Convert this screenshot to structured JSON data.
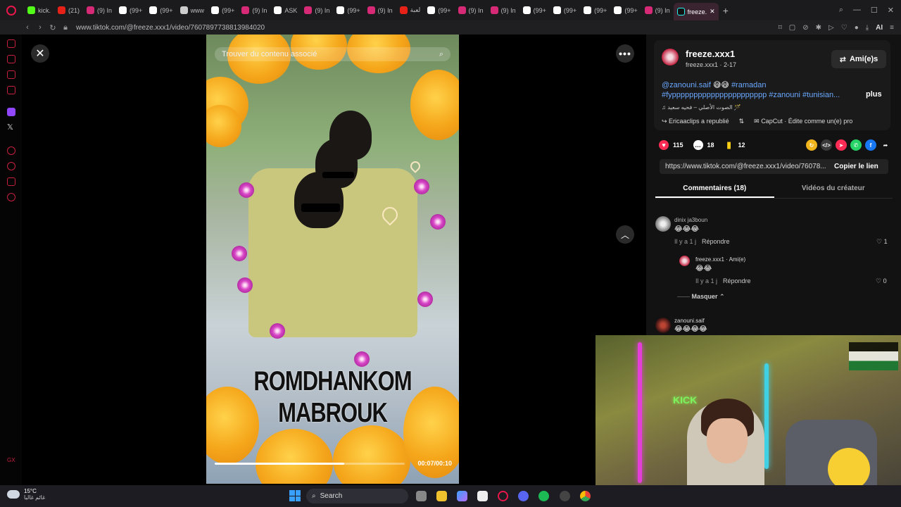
{
  "browser": {
    "tabs": [
      {
        "label": "kick.",
        "color": "#53fc18"
      },
      {
        "label": "(21)",
        "color": "#e62117"
      },
      {
        "label": "(9) In",
        "color": "#d62976"
      },
      {
        "label": "(99+",
        "color": "#ffffff"
      },
      {
        "label": "(99+",
        "color": "#ffffff"
      },
      {
        "label": "www",
        "color": "#cccccc"
      },
      {
        "label": "(99+",
        "color": "#ffffff"
      },
      {
        "label": "(9) In",
        "color": "#d62976"
      },
      {
        "label": "ASK",
        "color": "#ffffff"
      },
      {
        "label": "(9) In",
        "color": "#d62976"
      },
      {
        "label": "(99+",
        "color": "#ffffff"
      },
      {
        "label": "(9) In",
        "color": "#d62976"
      },
      {
        "label": "لعبة",
        "color": "#e62117"
      },
      {
        "label": "(99+",
        "color": "#ffffff"
      },
      {
        "label": "(9) In",
        "color": "#d62976"
      },
      {
        "label": "(9) In",
        "color": "#d62976"
      },
      {
        "label": "(99+",
        "color": "#ffffff"
      },
      {
        "label": "(99+",
        "color": "#ffffff"
      },
      {
        "label": "(99+",
        "color": "#ffffff"
      },
      {
        "label": "(99+",
        "color": "#ffffff"
      },
      {
        "label": "(9) In",
        "color": "#d62976"
      }
    ],
    "active_tab": "freeze.",
    "url": "www.tiktok.com/@freeze.xxx1/video/7607897738813984020",
    "ai_label": "AI"
  },
  "video": {
    "search_placeholder": "Trouver du contenu associé",
    "caption": "ROMDHANKOM MABROUK",
    "timecode": "00:07/00:10",
    "progress": 0.68
  },
  "post": {
    "author_name": "freeze.xxx1",
    "author_sub": "freeze.xxx1 · 2-17",
    "friends_button": "Ami(e)s",
    "desc_mention": "@zanouni.saif",
    "desc_emoji": "😅😅",
    "desc_tag1": "#ramadan",
    "desc_line2": "#fypppppppppppppppppppppp #zanouni #tunisian...",
    "more_label": "plus",
    "music": "الصوت الأصلي – فحيه سعيد 🪄",
    "repost_label": "Ericaaclips a republié",
    "capcut_label": "CapCut · Édite comme un(e) pro",
    "likes": "115",
    "comments": "18",
    "saves": "12",
    "link": "https://www.tiktok.com/@freeze.xxx1/video/76078...",
    "copy_label": "Copier le lien",
    "tab_comments": "Commentaires (18)",
    "tab_videos": "Vidéos du créateur"
  },
  "comments": [
    {
      "name": "dinix ja3boun",
      "text": "😂😂😂",
      "time": "Il y a 1 j",
      "reply": "Répondre",
      "likes": "1"
    },
    {
      "name": "freeze.xxx1 · Ami(e)",
      "text": "😂😂",
      "time": "Il y a 1 j",
      "reply": "Répondre",
      "likes": "0"
    },
    {
      "name": "zanouni.saif",
      "text": "😂😂😂😂"
    }
  ],
  "hide_replies": "Masquer",
  "webcam": {
    "sign": "KICK"
  },
  "taskbar": {
    "temp": "15°C",
    "weather_desc": "غائم غالبا",
    "search": "Search"
  }
}
